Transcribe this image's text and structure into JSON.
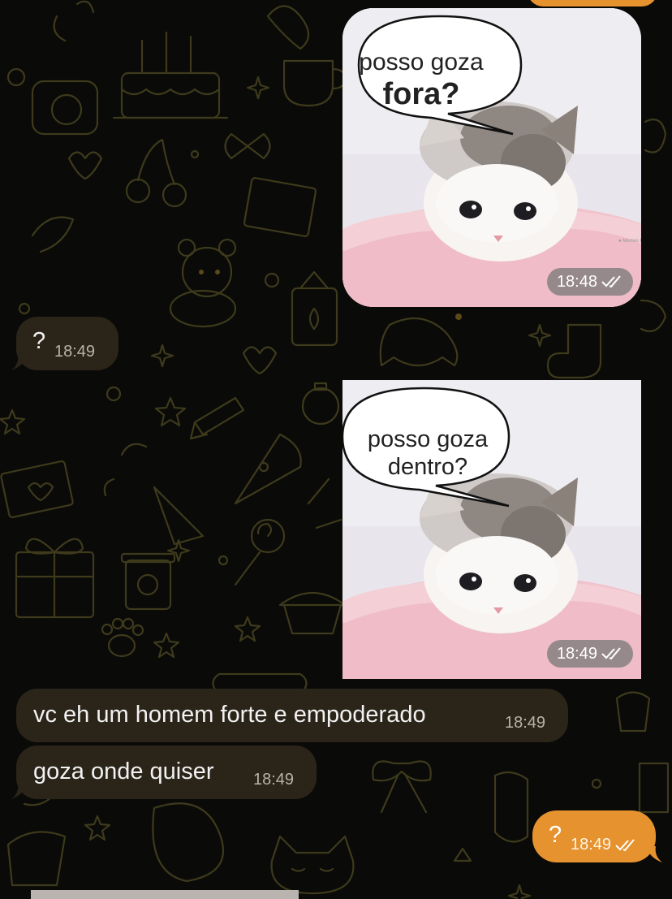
{
  "messages": [
    {
      "type": "sticker",
      "side": "out",
      "caption_line1": "posso goza",
      "caption_line2": "fora?",
      "time": "18:48"
    },
    {
      "type": "text",
      "side": "in",
      "text": "?",
      "time": "18:49"
    },
    {
      "type": "sticker",
      "side": "out",
      "caption_line1": "posso goza",
      "caption_line2": "dentro?",
      "time": "18:49"
    },
    {
      "type": "text",
      "side": "in",
      "text": "vc eh um homem forte e empoderado",
      "time": "18:49"
    },
    {
      "type": "text",
      "side": "in",
      "text": "goza onde quiser",
      "time": "18:49"
    },
    {
      "type": "text",
      "side": "out",
      "text": "?",
      "time": "18:49"
    }
  ],
  "colors": {
    "background": "#0a0a08",
    "incoming_bubble": "#2b2419",
    "outgoing_bubble": "#e6922f",
    "wallpaper_lines": "#4a4220"
  },
  "icons": {
    "read_receipt": "double-check-icon"
  }
}
